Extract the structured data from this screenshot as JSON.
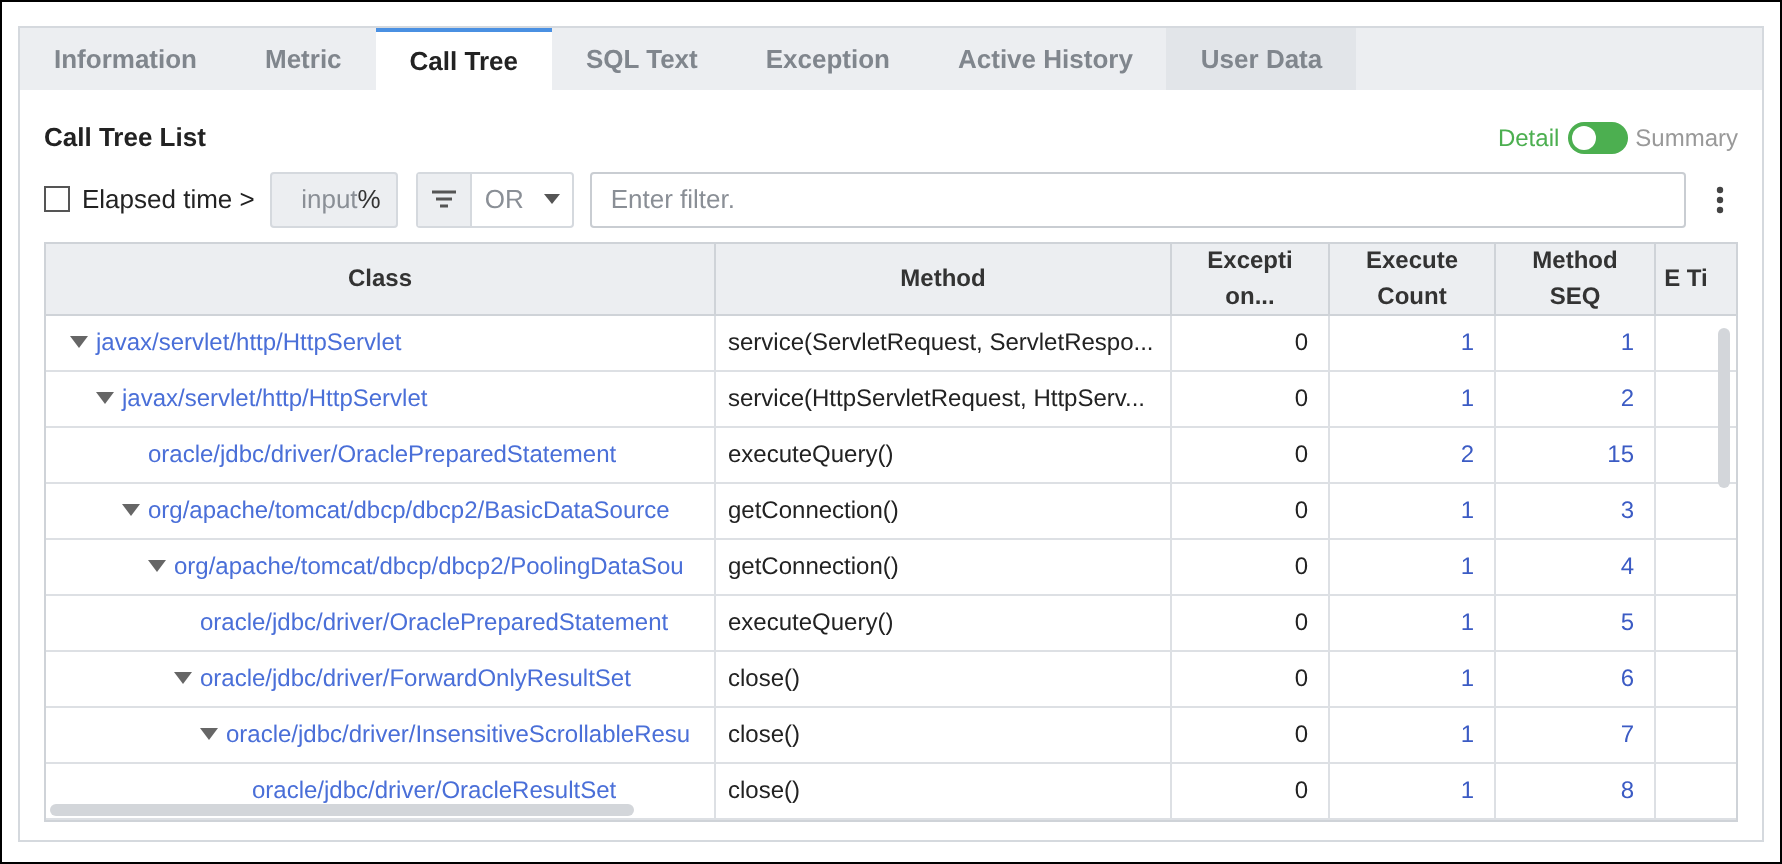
{
  "tabs": [
    {
      "label": "Information",
      "selected": false
    },
    {
      "label": "Metric",
      "selected": false
    },
    {
      "label": "Call Tree",
      "selected": true
    },
    {
      "label": "SQL Text",
      "selected": false
    },
    {
      "label": "Exception",
      "selected": false
    },
    {
      "label": "Active History",
      "selected": false
    },
    {
      "label": "User Data",
      "selected": false
    }
  ],
  "panel_title": "Call Tree List",
  "view_switch": {
    "on": false
  },
  "view_toggle": [
    {
      "label": "Detail",
      "selected": true
    },
    {
      "label": "Summary",
      "selected": false
    }
  ],
  "elapsed_filter": {
    "label": "Elapsed time >",
    "checked": false,
    "placeholder": "input",
    "unit": "%"
  },
  "operator": "OR",
  "filter": {
    "placeholder": "Enter filter."
  },
  "table": {
    "columns": [
      {
        "label": "Class"
      },
      {
        "label": "Method"
      },
      {
        "label": "Excepti on..."
      },
      {
        "label": "Execute Count"
      },
      {
        "label": "Method SEQ"
      },
      {
        "label": "E Ti"
      }
    ],
    "rows": [
      {
        "class": "javax/servlet/http/HttpServlet",
        "method": "service(ServletRequest, ServletRespo...",
        "exception": "0",
        "execute_count": "1",
        "method_seq": "1",
        "expanded": true,
        "children": [
          {
            "class": "javax/servlet/http/HttpServlet",
            "method": "service(HttpServletRequest, HttpServ...",
            "exception": "0",
            "execute_count": "1",
            "method_seq": "2",
            "expanded": true,
            "children": [
              {
                "class": "oracle/jdbc/driver/OraclePreparedStatement",
                "method": "executeQuery()",
                "exception": "0",
                "execute_count": "2",
                "method_seq": "15"
              },
              {
                "class": "org/apache/tomcat/dbcp/dbcp2/BasicDataSource",
                "method": "getConnection()",
                "exception": "0",
                "execute_count": "1",
                "method_seq": "3",
                "expanded": true,
                "children": [
                  {
                    "class": "org/apache/tomcat/dbcp/dbcp2/PoolingDataSou",
                    "method": "getConnection()",
                    "exception": "0",
                    "execute_count": "1",
                    "method_seq": "4",
                    "expanded": true,
                    "children": [
                      {
                        "class": "oracle/jdbc/driver/OraclePreparedStatement",
                        "method": "executeQuery()",
                        "exception": "0",
                        "execute_count": "1",
                        "method_seq": "5"
                      },
                      {
                        "class": "oracle/jdbc/driver/ForwardOnlyResultSet",
                        "method": "close()",
                        "exception": "0",
                        "execute_count": "1",
                        "method_seq": "6",
                        "expanded": true,
                        "children": [
                          {
                            "class": "oracle/jdbc/driver/InsensitiveScrollableResu",
                            "method": "close()",
                            "exception": "0",
                            "execute_count": "1",
                            "method_seq": "7",
                            "expanded": true,
                            "children": [
                              {
                                "class": "oracle/jdbc/driver/OracleResultSet",
                                "method": "close()",
                                "exception": "0",
                                "execute_count": "1",
                                "method_seq": "8"
                              }
                            ]
                          }
                        ]
                      }
                    ]
                  }
                ]
              }
            ]
          }
        ]
      }
    ]
  }
}
